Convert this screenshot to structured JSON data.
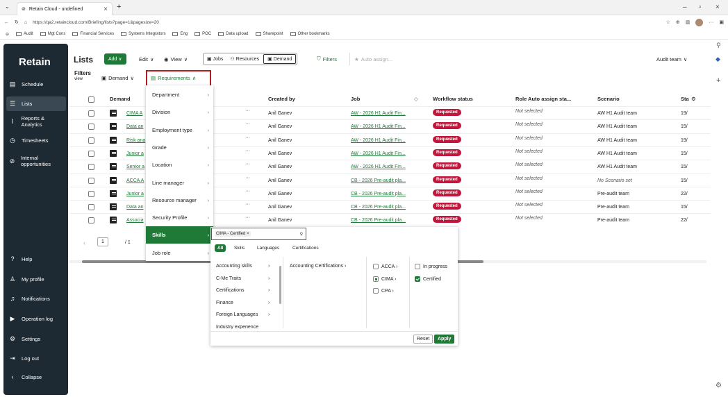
{
  "browser": {
    "tab_title": "Retain Cloud - undefined",
    "url": "https://qa2.retaincloud.com/Briefing/lists?page=1&pagesize=20",
    "bookmarks": [
      "Audit",
      "Mgt Cons",
      "Financial Services",
      "Systems Integrators",
      "Eng",
      "POC",
      "Data upload",
      "Sharepoint",
      "Other bookmarks"
    ]
  },
  "sidebar": {
    "brand": "Retain",
    "items": [
      {
        "label": "Schedule",
        "icon": "calendar-icon"
      },
      {
        "label": "Lists",
        "icon": "list-icon"
      },
      {
        "label": "Reports & Analytics",
        "icon": "chart-icon"
      },
      {
        "label": "Timesheets",
        "icon": "clock-icon"
      },
      {
        "label": "Internal opportunities",
        "icon": "link-icon"
      },
      {
        "label": "Help",
        "icon": "help-icon"
      },
      {
        "label": "My profile",
        "icon": "user-icon"
      },
      {
        "label": "Notifications",
        "icon": "bell-icon"
      },
      {
        "label": "Operation log",
        "icon": "log-icon"
      },
      {
        "label": "Settings",
        "icon": "gear-icon"
      },
      {
        "label": "Log out",
        "icon": "logout-icon"
      },
      {
        "label": "Collapse",
        "icon": "chevron-left-icon"
      }
    ]
  },
  "toolbar": {
    "title": "Lists",
    "add": "Add",
    "edit": "Edit",
    "view": "View",
    "seg": [
      "Jobs",
      "Resources",
      "Demand"
    ],
    "filters": "Filters",
    "auto_assign": "Auto assign...",
    "audit_team": "Audit team"
  },
  "filters": {
    "label": "Filters",
    "sub": "view",
    "demand": "Demand",
    "requirements": "Requirements"
  },
  "table": {
    "headers": [
      "Demand",
      "Created by",
      "Job",
      "Workflow status",
      "Role Auto assign sta...",
      "Scenario",
      "Sta"
    ],
    "rows": [
      {
        "demand": "CIMA A",
        "by": "Anil Ganev",
        "job": "AW - 2026 H1 Audit Fin...",
        "status": "Requested",
        "auto": "Not selected",
        "scenario": "AW H1 Audit team",
        "sta": "19/"
      },
      {
        "demand": "Data an",
        "by": "Anil Ganev",
        "job": "AW - 2026 H1 Audit Fin...",
        "status": "Requested",
        "auto": "Not selected",
        "scenario": "AW H1 Audit team",
        "sta": "15/"
      },
      {
        "demand": "Risk ana",
        "by": "Anil Ganev",
        "job": "AW - 2026 H1 Audit Fin...",
        "status": "Requested",
        "auto": "Not selected",
        "scenario": "AW H1 Audit team",
        "sta": "19/"
      },
      {
        "demand": "Junior a",
        "by": "Anil Ganev",
        "job": "AW - 2026 H1 Audit Fin...",
        "status": "Requested",
        "auto": "Not selected",
        "scenario": "AW H1 Audit team",
        "sta": "15/"
      },
      {
        "demand": "Senior a",
        "by": "Anil Ganev",
        "job": "AW - 2026 H1 Audit Fin...",
        "status": "Requested",
        "auto": "Not selected",
        "scenario": "AW H1 Audit team",
        "sta": "15/"
      },
      {
        "demand": "ACCA A",
        "by": "Anil Ganev",
        "job": "CB - 2026 Pre-audit pla...",
        "status": "Requested",
        "auto": "Not selected",
        "scenario": "No Scenario set",
        "sta": "15/"
      },
      {
        "demand": "Junior a",
        "by": "Anil Ganev",
        "job": "CB - 2026 Pre-audit pla...",
        "status": "Requested",
        "auto": "Not selected",
        "scenario": "Pre-audit team",
        "sta": "22/"
      },
      {
        "demand": "Data an",
        "by": "Anil Ganev",
        "job": "CB - 2026 Pre-audit pla...",
        "status": "Requested",
        "auto": "Not selected",
        "scenario": "Pre-audit team",
        "sta": "15/"
      },
      {
        "demand": "Associa",
        "by": "Anil Ganev",
        "job": "CB - 2026 Pre-audit pla...",
        "status": "Requested",
        "auto": "Not selected",
        "scenario": "Pre-audit team",
        "sta": "22/"
      }
    ],
    "page": "1",
    "of": "/ 1"
  },
  "menu": [
    "Department",
    "Division",
    "Employment type",
    "Grade",
    "Location",
    "Line manager",
    "Resource manager",
    "Security Profile",
    "Skills",
    "Job role"
  ],
  "skills": {
    "chip": "CIMA - Certified",
    "tabs": [
      "All",
      "Skills",
      "Languages",
      "Certifications"
    ],
    "col1": [
      "Accounting skills",
      "C-Me Traits",
      "Certifications",
      "Finance",
      "Foreign Languages",
      "Industry experience"
    ],
    "col2": [
      "Accounting Certifications"
    ],
    "col3": [
      "ACCA",
      "CIMA",
      "CPA"
    ],
    "col4": [
      "In progress",
      "Certified"
    ],
    "reset": "Reset",
    "apply": "Apply"
  },
  "colors": {
    "green": "#1f7a38",
    "badge": "#c1173c",
    "sidebar": "#1e2a33",
    "highlight": "#b01e22"
  }
}
